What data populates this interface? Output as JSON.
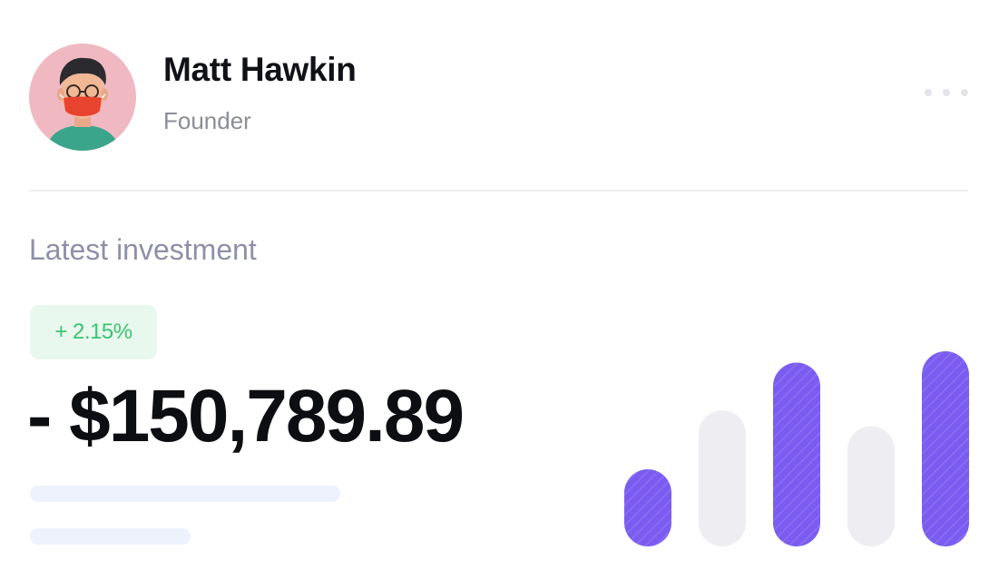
{
  "profile": {
    "name": "Matt Hawkin",
    "role": "Founder"
  },
  "section": {
    "label": "Latest investment"
  },
  "investment": {
    "change": "+ 2.15%",
    "amount": "- $150,789.89"
  },
  "icons": {
    "avatar": "avatar-icon",
    "more": "more-horizontal-icon"
  },
  "colors": {
    "accent": "#7b5cf0",
    "inactive_bar": "#eeeef2",
    "positive": "#3cc371",
    "positive_bg": "#e9f8ee",
    "skeleton": "#edf2fd"
  },
  "chart_data": {
    "type": "bar",
    "categories": [
      "",
      "",
      "",
      "",
      ""
    ],
    "values": [
      0.34,
      0.6,
      0.81,
      0.53,
      0.86
    ],
    "highlighted": [
      true,
      false,
      true,
      false,
      true
    ],
    "ylim": [
      0,
      1
    ],
    "title": "",
    "xlabel": "",
    "ylabel": ""
  }
}
